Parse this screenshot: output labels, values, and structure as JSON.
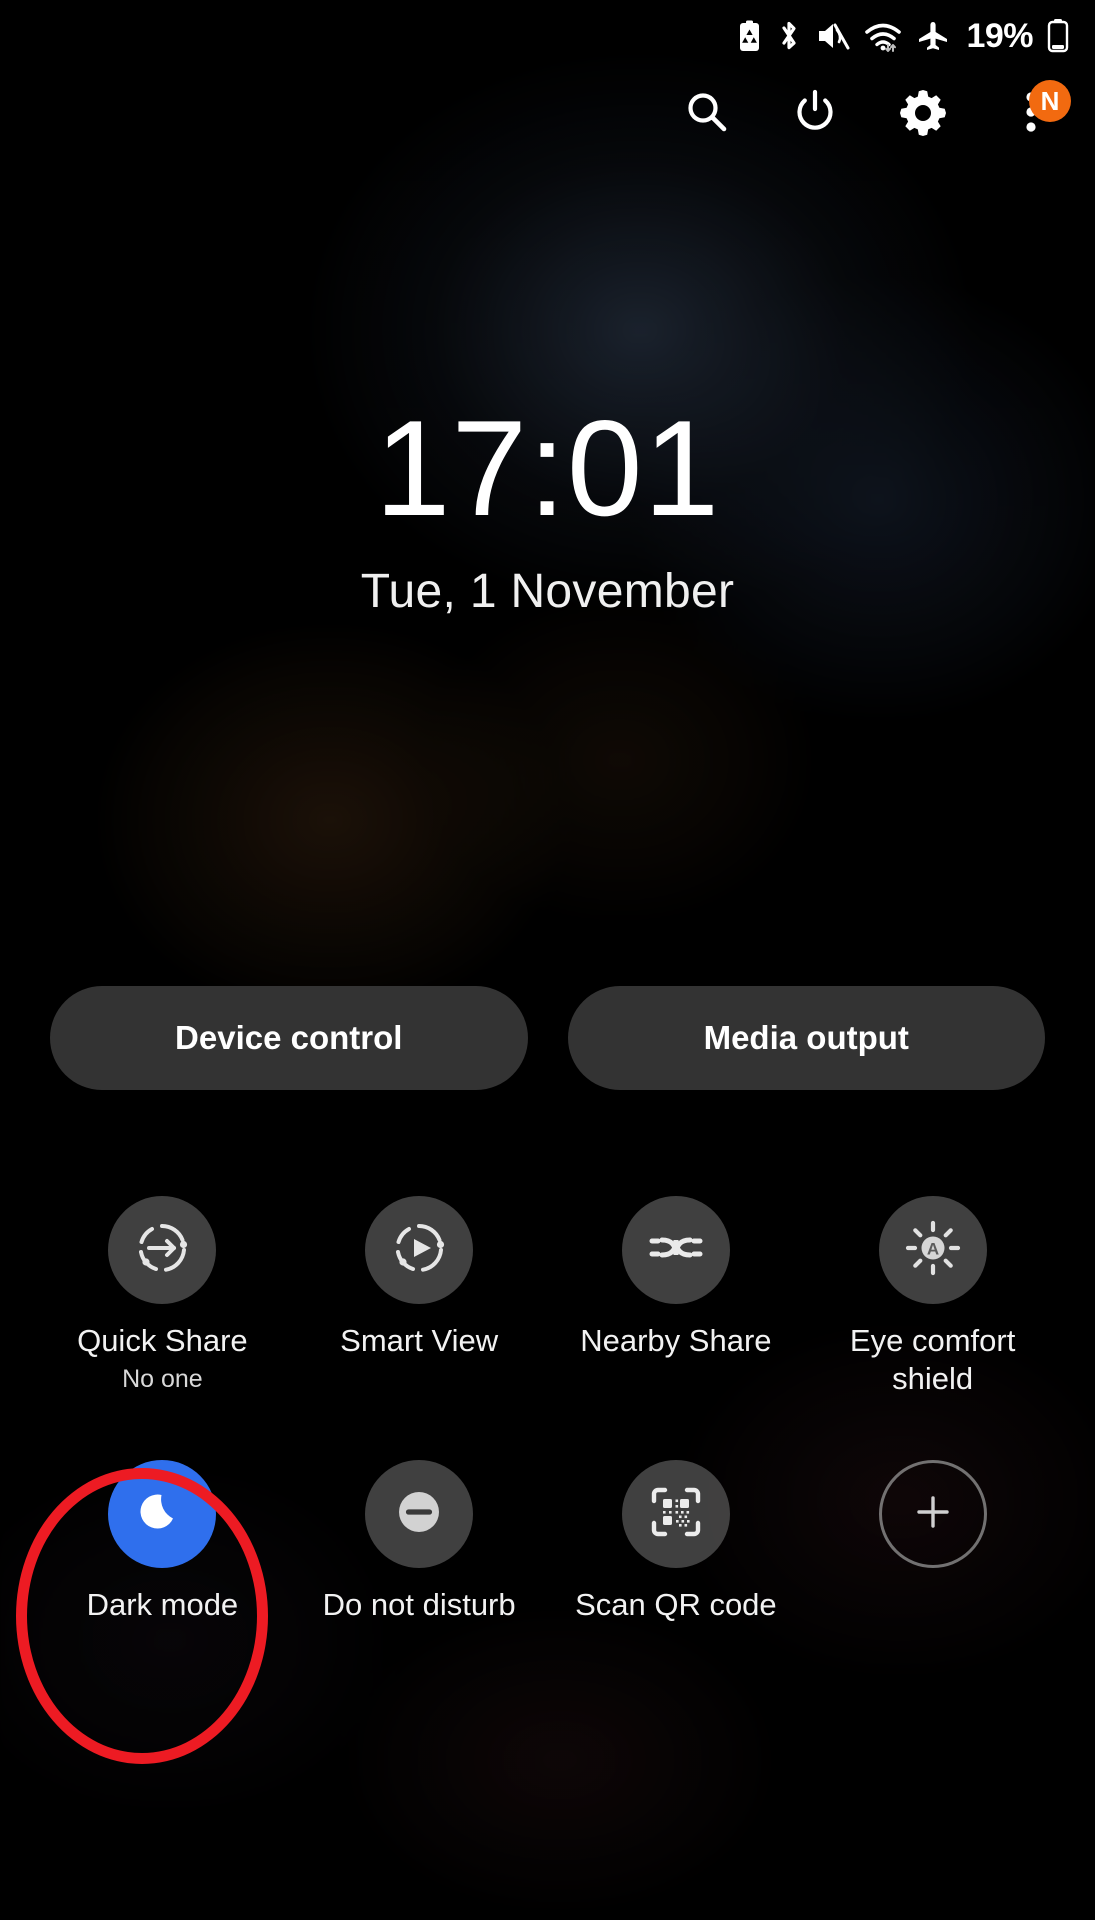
{
  "status_bar": {
    "icons": [
      {
        "name": "battery-saver-icon",
        "glyph": "recycle-battery"
      },
      {
        "name": "bluetooth-icon",
        "glyph": "bluetooth"
      },
      {
        "name": "mute-icon",
        "glyph": "speaker-muted"
      },
      {
        "name": "wifi-icon",
        "glyph": "wifi"
      },
      {
        "name": "airplane-mode-icon",
        "glyph": "airplane"
      }
    ],
    "battery_percent": "19%"
  },
  "panel_header": {
    "search_label": "search-icon",
    "power_label": "power-icon",
    "settings_label": "gear-icon",
    "menu_label": "more-options-icon",
    "badge_text": "N",
    "badge_color": "#f26a10"
  },
  "clock": {
    "time": "17:01",
    "date": "Tue, 1 November"
  },
  "pills": [
    {
      "label": "Device control"
    },
    {
      "label": "Media output"
    }
  ],
  "tiles_row_1": [
    {
      "label": "Quick Share",
      "sublabel": "No one",
      "icon": "quick-share-icon",
      "active": false
    },
    {
      "label": "Smart View",
      "sublabel": "",
      "icon": "smart-view-icon",
      "active": false
    },
    {
      "label": "Nearby Share",
      "sublabel": "",
      "icon": "nearby-share-icon",
      "active": false
    },
    {
      "label": "Eye comfort shield",
      "sublabel": "",
      "icon": "eye-comfort-shield-icon",
      "active": false
    }
  ],
  "tiles_row_2": [
    {
      "label": "Dark mode",
      "sublabel": "",
      "icon": "moon-icon",
      "active": true
    },
    {
      "label": "Do not disturb",
      "sublabel": "",
      "icon": "do-not-disturb-icon",
      "active": false
    },
    {
      "label": "Scan QR code",
      "sublabel": "",
      "icon": "qr-scan-icon",
      "active": false
    },
    {
      "label": "",
      "sublabel": "",
      "icon": "plus-icon",
      "active": false
    }
  ],
  "annotation": {
    "target": "Dark mode",
    "color": "#ed1b23",
    "shape": "ellipse"
  },
  "colors": {
    "accent_active": "#2f6fed",
    "badge": "#f26a10",
    "annotation": "#ed1b23",
    "tile_inactive": "rgba(104,104,104,0.62)",
    "pill_bg": "rgba(58,58,58,0.88)"
  }
}
